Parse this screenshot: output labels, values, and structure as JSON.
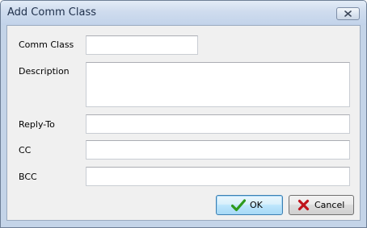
{
  "window": {
    "title": "Add Comm Class"
  },
  "form": {
    "comm_class": {
      "label": "Comm Class",
      "value": ""
    },
    "description": {
      "label": "Description",
      "value": ""
    },
    "reply_to": {
      "label": "Reply-To",
      "value": ""
    },
    "cc": {
      "label": "CC",
      "value": ""
    },
    "bcc": {
      "label": "BCC",
      "value": ""
    }
  },
  "buttons": {
    "ok": {
      "label": "OK",
      "icon": "checkmark-icon",
      "icon_color": "#2e9a1e"
    },
    "cancel": {
      "label": "Cancel",
      "icon": "x-icon",
      "icon_color": "#c0141c"
    }
  },
  "colors": {
    "titlebar": "#cfdcee",
    "client_background": "#f0f0f0",
    "default_button_border": "#3c7fb1"
  }
}
